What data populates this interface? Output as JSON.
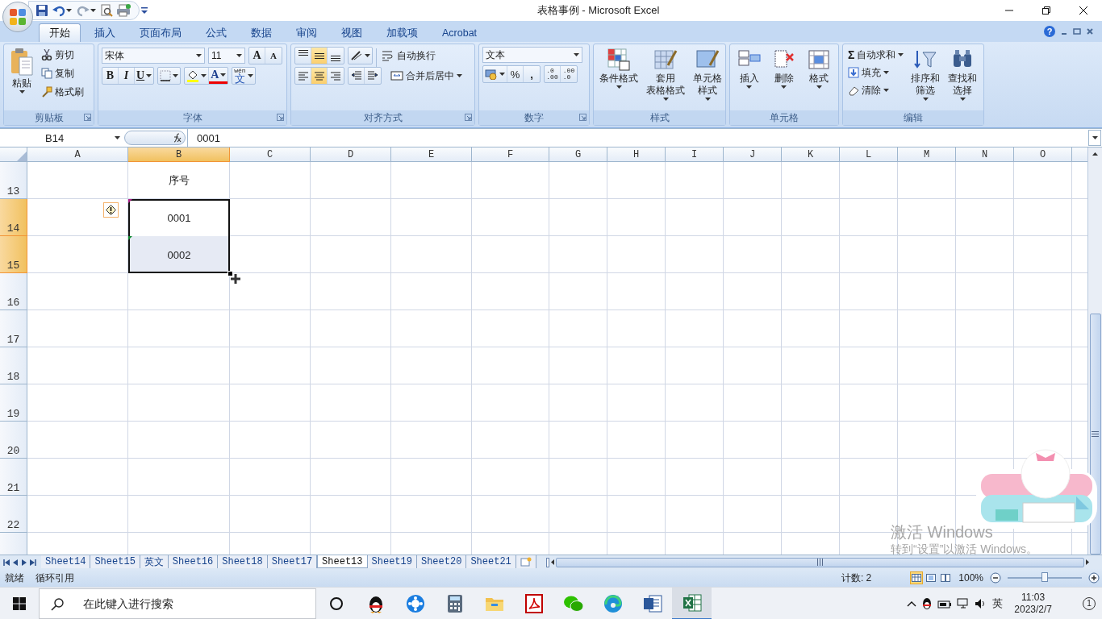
{
  "window": {
    "title": "表格事例 - Microsoft Excel"
  },
  "ribbon_tabs": [
    {
      "label": "开始",
      "selected": true
    },
    {
      "label": "插入",
      "selected": false
    },
    {
      "label": "页面布局",
      "selected": false
    },
    {
      "label": "公式",
      "selected": false
    },
    {
      "label": "数据",
      "selected": false
    },
    {
      "label": "审阅",
      "selected": false
    },
    {
      "label": "视图",
      "selected": false
    },
    {
      "label": "加载项",
      "selected": false
    },
    {
      "label": "Acrobat",
      "selected": false
    }
  ],
  "ribbon_help": "?",
  "clipboard": {
    "title": "剪贴板",
    "paste": "粘贴",
    "items": [
      "剪切",
      "复制",
      "格式刷"
    ]
  },
  "font": {
    "title": "字体",
    "name": "宋体",
    "size": "11",
    "grow": "A",
    "shrink": "A",
    "style_buttons": [
      "B",
      "I",
      "U"
    ],
    "fill_letter": "A",
    "phonetic_top": "wén",
    "phonetic": "文"
  },
  "alignment": {
    "title": "对齐方式",
    "vertical": [
      {
        "selected": false
      },
      {
        "selected": true
      },
      {
        "selected": false
      }
    ],
    "horizontal": [
      {
        "selected": false
      },
      {
        "selected": true
      },
      {
        "selected": false
      }
    ],
    "wrap_text": "自动换行",
    "merge": "合并后居中"
  },
  "number": {
    "title": "数字",
    "format": "文本",
    "percent": "%",
    "comma": ",",
    "increase_decimal": [
      ".0",
      ".00"
    ],
    "decrease_decimal": [
      ".00",
      ".0"
    ]
  },
  "styles": {
    "title": "样式",
    "buttons": [
      [
        "条件格式"
      ],
      [
        "套用",
        "表格格式"
      ],
      [
        "单元格",
        "样式"
      ]
    ]
  },
  "cells": {
    "title": "单元格",
    "buttons": [
      "插入",
      "删除",
      "格式"
    ]
  },
  "editing": {
    "title": "编辑",
    "sum_symbol": "Σ",
    "items": [
      "自动求和",
      "填充",
      "清除"
    ],
    "buttons": [
      [
        "排序和",
        "筛选"
      ],
      [
        "查找和",
        "选择"
      ]
    ]
  },
  "formula_bar": {
    "name_box": "B14",
    "formula": "0001"
  },
  "columns": [
    {
      "label": "A",
      "selected": false
    },
    {
      "label": "B",
      "selected": true
    },
    {
      "label": "C",
      "selected": false
    },
    {
      "label": "D",
      "selected": false
    },
    {
      "label": "E",
      "selected": false
    },
    {
      "label": "F",
      "selected": false
    },
    {
      "label": "G",
      "selected": false
    },
    {
      "label": "H",
      "selected": false
    },
    {
      "label": "I",
      "selected": false
    },
    {
      "label": "J",
      "selected": false
    },
    {
      "label": "K",
      "selected": false
    },
    {
      "label": "L",
      "selected": false
    },
    {
      "label": "M",
      "selected": false
    },
    {
      "label": "N",
      "selected": false
    },
    {
      "label": "O",
      "selected": false
    }
  ],
  "rows": [
    {
      "label": "13",
      "selected": false,
      "flagged": false,
      "column_b": "序号"
    },
    {
      "label": "14",
      "selected": true,
      "flagged": true,
      "column_b": "0001"
    },
    {
      "label": "15",
      "selected": true,
      "flagged": true,
      "column_b": "0002"
    },
    {
      "label": "16",
      "selected": false,
      "flagged": false
    },
    {
      "label": "17",
      "selected": false,
      "flagged": false
    },
    {
      "label": "18",
      "selected": false,
      "flagged": false
    },
    {
      "label": "19",
      "selected": false,
      "flagged": false
    },
    {
      "label": "20",
      "selected": false,
      "flagged": false
    },
    {
      "label": "21",
      "selected": false,
      "flagged": false
    },
    {
      "label": "22",
      "selected": false,
      "flagged": false
    }
  ],
  "sheet_tabs": [
    {
      "label": "Sheet14",
      "selected": false
    },
    {
      "label": "Sheet15",
      "selected": false
    },
    {
      "label": "英文",
      "selected": false
    },
    {
      "label": "Sheet16",
      "selected": false
    },
    {
      "label": "Sheet18",
      "selected": false
    },
    {
      "label": "Sheet17",
      "selected": false
    },
    {
      "label": "Sheet13",
      "selected": true
    },
    {
      "label": "Sheet19",
      "selected": false
    },
    {
      "label": "Sheet20",
      "selected": false
    },
    {
      "label": "Sheet21",
      "selected": false
    }
  ],
  "status_bar": {
    "mode": "就绪",
    "message": "循环引用",
    "count": "计数: 2",
    "views": [
      {
        "selected": true
      },
      {
        "selected": false
      },
      {
        "selected": false
      }
    ],
    "zoom": "100%",
    "zoom_slider": {
      "level": 0.5
    }
  },
  "activation_notice": {
    "title": "激活 Windows",
    "subtitle": "转到“设置”以激活 Windows。"
  },
  "taskbar": {
    "search_placeholder": "在此键入进行搜索",
    "apps": [
      {
        "kind": "qq",
        "selected": false
      },
      {
        "kind": "video",
        "selected": false
      },
      {
        "kind": "calculator",
        "selected": false
      },
      {
        "kind": "folder",
        "selected": false
      },
      {
        "kind": "pdf",
        "selected": false
      },
      {
        "kind": "wechat",
        "selected": false
      },
      {
        "kind": "edge",
        "selected": false
      },
      {
        "kind": "word",
        "selected": false
      },
      {
        "kind": "excel",
        "selected": true
      }
    ],
    "input_method": "英",
    "time": "11:03",
    "date": "2023/2/7",
    "notifications": "1"
  }
}
